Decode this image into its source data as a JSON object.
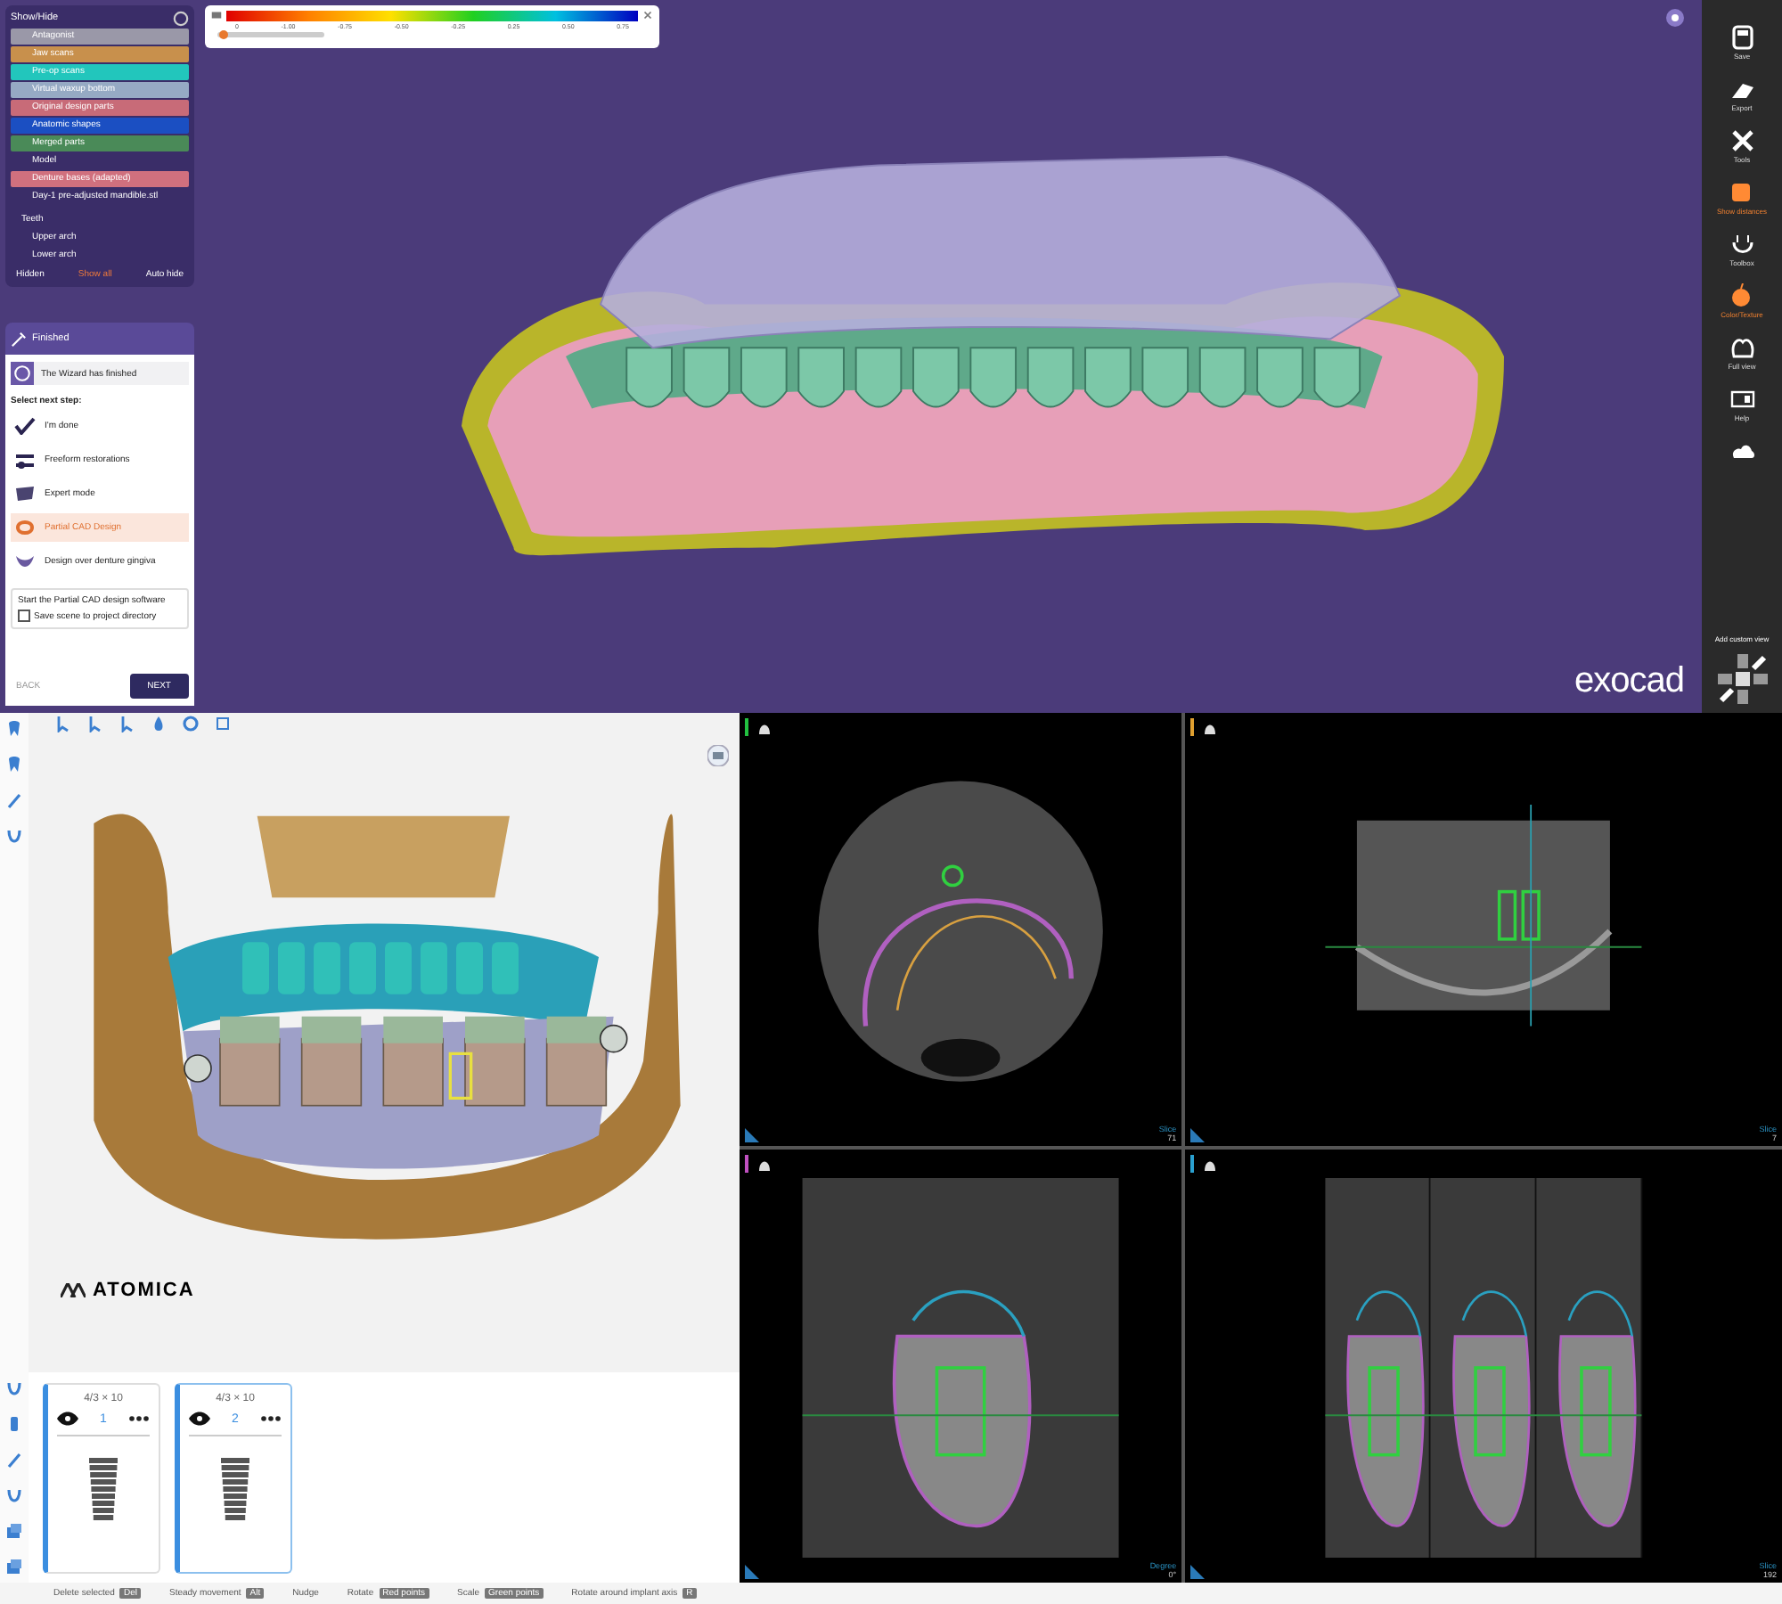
{
  "exocad": {
    "color_scale": {
      "ticks": [
        "0",
        "-1.00",
        "-0.75",
        "-0.50",
        "-0.25",
        "0.25",
        "0.50",
        "0.75"
      ],
      "level": 0.02
    },
    "show_hide": {
      "title": "Show/Hide",
      "items": [
        {
          "label": "Antagonist",
          "color": "#9a98a8"
        },
        {
          "label": "Jaw scans",
          "color": "#c8904c"
        },
        {
          "label": "Pre-op scans",
          "color": "#22c6bc"
        },
        {
          "label": "Virtual waxup bottom",
          "color": "#96aac4"
        },
        {
          "label": "Original design parts",
          "color": "#c86b78"
        },
        {
          "label": "Anatomic shapes",
          "color": "#1b4fc2"
        },
        {
          "label": "Merged parts",
          "color": "#4a8a58"
        },
        {
          "label": "Model"
        },
        {
          "label": "Denture bases (adapted)",
          "color": "#d0707e"
        },
        {
          "label": "Day-1 pre-adjusted mandible.stl"
        }
      ],
      "teeth": {
        "label": "Teeth",
        "items": [
          {
            "label": "Upper arch"
          },
          {
            "label": "Lower arch"
          }
        ]
      },
      "hidden": {
        "label": "Hidden",
        "show_all": "Show all",
        "auto_hide": "Auto hide"
      }
    },
    "wizard": {
      "title": "Finished",
      "message": "The Wizard has finished",
      "prompt": "Select next step:",
      "steps": [
        {
          "label": "I'm done",
          "kind": "check",
          "selected": false
        },
        {
          "label": "Freeform restorations",
          "kind": "freeform",
          "selected": false
        },
        {
          "label": "Expert mode",
          "kind": "expert",
          "selected": false
        },
        {
          "label": "Partial CAD Design",
          "kind": "partial",
          "selected": true
        },
        {
          "label": "Design over denture gingiva",
          "kind": "gingiva",
          "selected": false
        }
      ],
      "note": "Start the Partial CAD design software",
      "save_option": {
        "label": "Save scene to project directory",
        "checked": false
      },
      "back": "BACK",
      "next": "NEXT"
    },
    "logo": "exocad",
    "toolbar": [
      {
        "label": "Save",
        "kind": "save",
        "active": false
      },
      {
        "label": "Export",
        "kind": "export",
        "active": false
      },
      {
        "label": "Tools",
        "kind": "tools",
        "active": false
      },
      {
        "label": "Show distances",
        "kind": "distances",
        "active": true
      },
      {
        "label": "Toolbox",
        "kind": "toolbox",
        "active": false
      },
      {
        "label": "Color/Texture",
        "kind": "texture",
        "active": true
      },
      {
        "label": "Full view",
        "kind": "fullview",
        "active": false
      },
      {
        "label": "Help",
        "kind": "help",
        "active": false
      },
      {
        "kind": "cloud",
        "active": false
      }
    ],
    "custom_view": "Add custom view"
  },
  "atomica": {
    "logo": "ATOMICA",
    "implants": [
      {
        "size": "4/3 × 10",
        "number": "1",
        "selected": false
      },
      {
        "size": "4/3 × 10",
        "number": "2",
        "selected": true
      }
    ],
    "views": [
      {
        "kind": "axial",
        "color": "#22c040",
        "caption": "Slice",
        "value": "71"
      },
      {
        "kind": "panoramic",
        "color": "#e0a030",
        "caption": "Slice",
        "value": "7"
      },
      {
        "kind": "cross",
        "color": "#c050c0",
        "caption": "Degree",
        "value": "0°"
      },
      {
        "kind": "series",
        "color": "#2aa0d0",
        "caption": "Slice",
        "value": "192"
      }
    ],
    "status_bar": [
      {
        "label": "Delete selected",
        "key": "Del"
      },
      {
        "label": "Steady movement",
        "key": "Alt"
      },
      {
        "label": "Nudge"
      },
      {
        "label": "Rotate",
        "key": "Red points"
      },
      {
        "label": "Scale",
        "key": "Green points"
      },
      {
        "label": "Rotate around implant axis",
        "key": "R"
      }
    ]
  }
}
